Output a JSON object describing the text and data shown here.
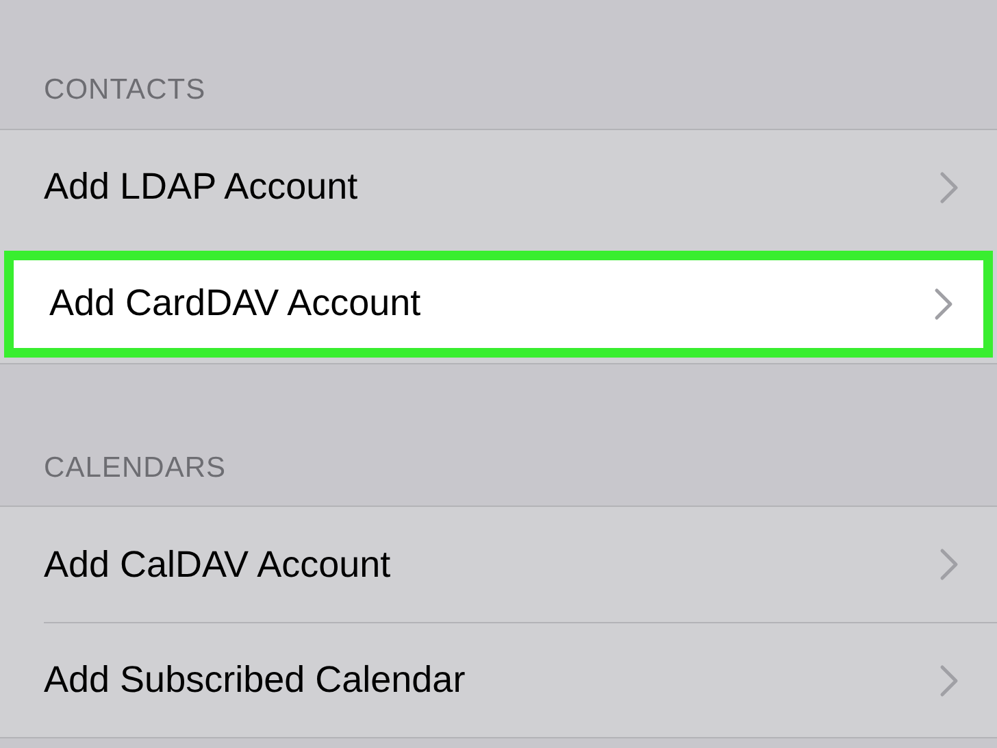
{
  "sections": [
    {
      "header": "CONTACTS",
      "items": [
        {
          "label": "Add LDAP Account",
          "selected": false
        },
        {
          "label": "Add CardDAV Account",
          "selected": true
        }
      ]
    },
    {
      "header": "CALENDARS",
      "items": [
        {
          "label": "Add CalDAV Account",
          "selected": false
        },
        {
          "label": "Add Subscribed Calendar",
          "selected": false
        }
      ]
    }
  ]
}
